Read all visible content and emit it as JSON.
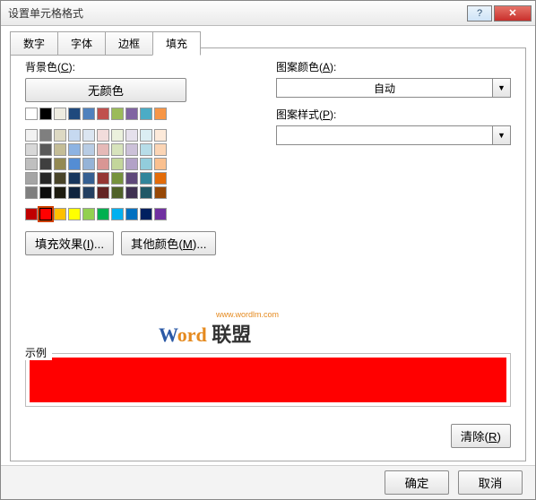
{
  "window": {
    "title": "设置单元格格式"
  },
  "tabs": {
    "number": "数字",
    "font": "字体",
    "border": "边框",
    "fill": "填充"
  },
  "left": {
    "bgcolor_label_pre": "背景色(",
    "bgcolor_label_u": "C",
    "bgcolor_label_post": "):",
    "nocolor": "无颜色",
    "fill_effects": "填充效果(",
    "fill_effects_u": "I",
    "fill_effects_post": ")...",
    "more_colors": "其他颜色(",
    "more_colors_u": "M",
    "more_colors_post": ")..."
  },
  "right": {
    "pattern_color_label_pre": "图案颜色(",
    "pattern_color_u": "A",
    "pattern_color_post": "):",
    "pattern_color_value": "自动",
    "pattern_style_label_pre": "图案样式(",
    "pattern_style_u": "P",
    "pattern_style_post": "):",
    "pattern_style_value": ""
  },
  "sample": {
    "label": "示例",
    "color": "#ff0000"
  },
  "clear": {
    "pre": "清除(",
    "u": "R",
    "post": ")"
  },
  "footer": {
    "ok": "确定",
    "cancel": "取消"
  },
  "watermark": {
    "w": "W",
    "ord": "ord",
    "cn": "联盟",
    "url": "www.wordlm.com"
  },
  "palette": {
    "row1": [
      "#ffffff",
      "#000000",
      "#eeece1",
      "#1f497d",
      "#4f81bd",
      "#c0504d",
      "#9bbb59",
      "#8064a2",
      "#4bacc6",
      "#f79646"
    ],
    "row2": [
      "#f2f2f2",
      "#7f7f7f",
      "#ddd9c3",
      "#c6d9f0",
      "#dbe5f1",
      "#f2dcdb",
      "#ebf1dd",
      "#e5e0ec",
      "#dbeef3",
      "#fdeada"
    ],
    "row3": [
      "#d8d8d8",
      "#595959",
      "#c4bd97",
      "#8db3e2",
      "#b8cce4",
      "#e5b9b7",
      "#d7e3bc",
      "#ccc1d9",
      "#b7dde8",
      "#fbd5b5"
    ],
    "row4": [
      "#bfbfbf",
      "#3f3f3f",
      "#938953",
      "#548dd4",
      "#95b3d7",
      "#d99694",
      "#c3d69b",
      "#b2a2c7",
      "#92cddc",
      "#fac08f"
    ],
    "row5": [
      "#a5a5a5",
      "#262626",
      "#494429",
      "#17365d",
      "#366092",
      "#953734",
      "#76923c",
      "#5f497a",
      "#31859b",
      "#e36c09"
    ],
    "row6": [
      "#7f7f7f",
      "#0c0c0c",
      "#1d1b10",
      "#0f243e",
      "#244061",
      "#632423",
      "#4f6128",
      "#3f3151",
      "#205867",
      "#974806"
    ],
    "std": [
      "#c00000",
      "#ff0000",
      "#ffc000",
      "#ffff00",
      "#92d050",
      "#00b050",
      "#00b0f0",
      "#0070c0",
      "#002060",
      "#7030a0"
    ],
    "selected": "#ff0000"
  }
}
